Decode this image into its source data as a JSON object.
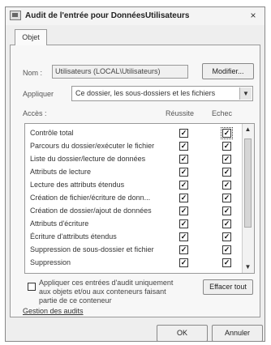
{
  "window": {
    "title": "Audit de l'entrée pour DonnéesUtilisateurs",
    "close_glyph": "×"
  },
  "tabs": [
    {
      "label": "Objet"
    }
  ],
  "name_row": {
    "label": "Nom :",
    "value": "Utilisateurs (LOCAL\\Utilisateurs)",
    "modify_button": "Modifier..."
  },
  "apply_row": {
    "label": "Appliquer",
    "value": "Ce dossier, les sous-dossiers et les fichiers"
  },
  "access": {
    "label": "Accès :",
    "col_success": "Réussite",
    "col_failure": "Echec",
    "rows": [
      {
        "label": "Contrôle total",
        "success": true,
        "failure": true
      },
      {
        "label": "Parcours du dossier/exécuter le fichier",
        "success": true,
        "failure": true
      },
      {
        "label": "Liste du dossier/lecture de données",
        "success": true,
        "failure": true
      },
      {
        "label": "Attributs de lecture",
        "success": true,
        "failure": true
      },
      {
        "label": "Lecture des attributs étendus",
        "success": true,
        "failure": true
      },
      {
        "label": "Création de fichier/écriture de donn...",
        "success": true,
        "failure": true
      },
      {
        "label": "Création de dossier/ajout de données",
        "success": true,
        "failure": true
      },
      {
        "label": "Attributs d'écriture",
        "success": true,
        "failure": true
      },
      {
        "label": "Écriture d'attributs étendus",
        "success": true,
        "failure": true
      },
      {
        "label": "Suppression de sous-dossier et fichier",
        "success": true,
        "failure": true
      },
      {
        "label": "Suppression",
        "success": true,
        "failure": true
      }
    ]
  },
  "apply_only": {
    "text_1": "Appliquer ces entrées d'audit uniquement",
    "text_2": "aux objets et/ou aux conteneurs faisant",
    "text_3": "partie de ce conteneur",
    "checked": false
  },
  "clear_all_button": "Effacer tout",
  "manage_link": "Gestion des audits",
  "footer": {
    "ok": "OK",
    "cancel": "Annuler"
  },
  "check_glyph": "✓"
}
